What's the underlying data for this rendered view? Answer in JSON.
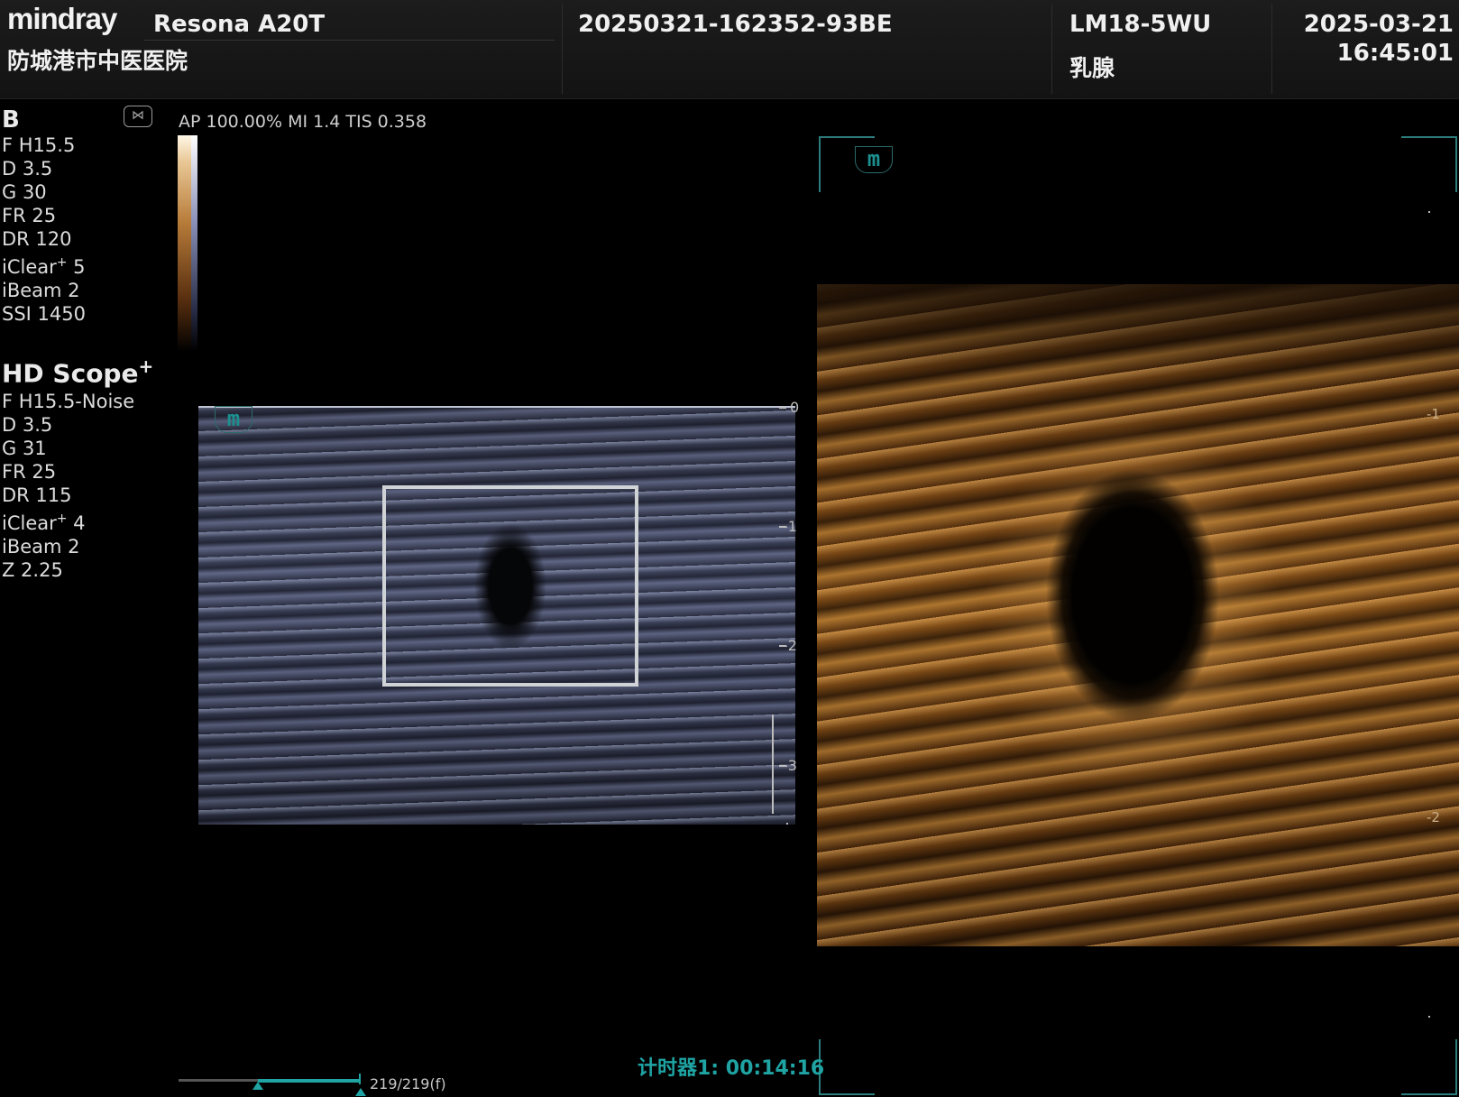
{
  "header": {
    "brand": "mindray",
    "model": "Resona A20T",
    "hospital": "防城港市中医医院",
    "patient_id": "20250321-162352-93BE",
    "probe": "LM18-5WU",
    "exam": "乳腺",
    "date": "2025-03-21",
    "time": "16:45:01"
  },
  "acoustic": {
    "line": "AP 100.00%  MI 1.4 TIS 0.358"
  },
  "bmode_params": {
    "title": "B",
    "items": [
      "F H15.5",
      "D 3.5",
      "G 30",
      "FR 25",
      "DR 120"
    ],
    "iclear_base": "iClear",
    "iclear_sup": "+",
    "iclear_value": " 5",
    "items2": [
      "iBeam 2",
      "SSI 1450"
    ]
  },
  "hdscope_params": {
    "title": "HD Scope",
    "title_sup": "+",
    "items": [
      "F H15.5-Noise",
      "D 3.5",
      "G 31",
      "FR 25",
      "DR 115"
    ],
    "iclear_base": "iClear",
    "iclear_sup": "+",
    "iclear_value": " 4",
    "items2": [
      "iBeam 2",
      "Z 2.25"
    ]
  },
  "icons": {
    "dual_view": "⋈",
    "logo_mark": "m"
  },
  "depth_scale": {
    "labels": [
      "0",
      "-1",
      "-2",
      "-3"
    ]
  },
  "zoom_depth": {
    "labels": [
      "-1",
      "-2"
    ]
  },
  "cine": {
    "timer": "计时器1: 00:14:16",
    "frames": "219/219(f)",
    "progress": 1.0
  },
  "colors": {
    "accent": "#1fa3a3",
    "roi_box": "#cfd3d6"
  }
}
